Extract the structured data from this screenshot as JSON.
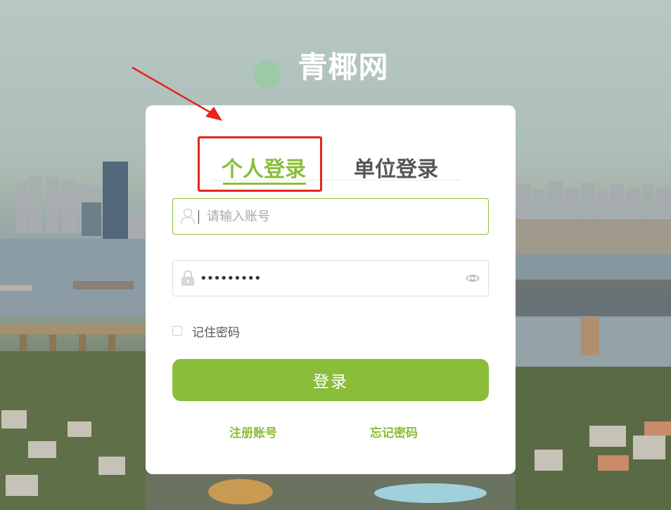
{
  "site": {
    "title": "青椰网"
  },
  "tabs": [
    {
      "label": "个人登录",
      "active": true
    },
    {
      "label": "单位登录",
      "active": false
    }
  ],
  "form": {
    "username": {
      "placeholder": "请输入账号",
      "value": "",
      "icon": "user-icon"
    },
    "password": {
      "value": "•••••••••",
      "icon": "lock-icon",
      "toggle_icon": "eye-icon"
    },
    "remember_label": "记住密码",
    "remember_checked": false,
    "submit_label": "登录"
  },
  "links": {
    "register": "注册账号",
    "forgot": "忘记密码"
  },
  "colors": {
    "accent": "#8abd3a",
    "annotation": "#e8231f"
  }
}
